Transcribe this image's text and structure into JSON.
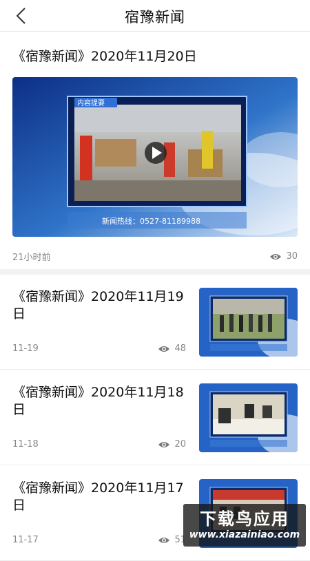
{
  "header": {
    "title": "宿豫新闻",
    "back_icon": "chevron-left-icon"
  },
  "featured": {
    "title": "《宿豫新闻》2020年11月20日",
    "overlay_label": "内容提要",
    "hotline": "新闻热线：0527-81189988",
    "time": "21小时前",
    "views": "30"
  },
  "items": [
    {
      "title": "《宿豫新闻》2020年11月19日",
      "date": "11-19",
      "views": "48"
    },
    {
      "title": "《宿豫新闻》2020年11月18日",
      "date": "11-18",
      "views": "20"
    },
    {
      "title": "《宿豫新闻》2020年11月17日",
      "date": "11-17",
      "views": "51"
    }
  ],
  "watermark": {
    "title": "下载鸟应用",
    "url": "www.xiazainiao.com"
  },
  "colors": {
    "accent": "#1a5fb4",
    "text": "#111111",
    "meta": "#888888"
  }
}
